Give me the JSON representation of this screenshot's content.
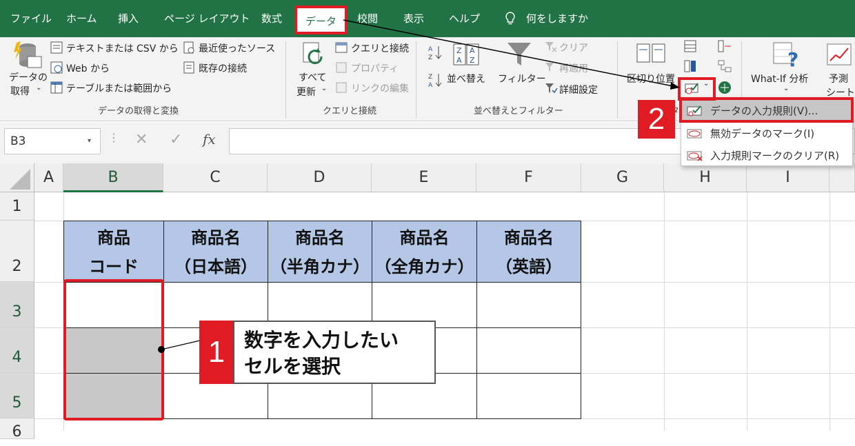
{
  "tabs": [
    "ファイル",
    "ホーム",
    "挿入",
    "ページ レイアウト",
    "数式",
    "データ",
    "校閲",
    "表示",
    "ヘルプ"
  ],
  "tell_me": "何をしますか",
  "ribbon": {
    "get_data": [
      "データの",
      "取得"
    ],
    "from_text_csv": "テキストまたは CSV から",
    "from_web": "Web から",
    "from_table": "テーブルまたは範囲から",
    "recent_sources": "最近使ったソース",
    "existing_connections": "既存の接続",
    "group_get_transform": "データの取得と変換",
    "refresh_all": [
      "すべて",
      "更新"
    ],
    "queries_connections": "クエリと接続",
    "properties": "プロパティ",
    "edit_links": "リンクの編集",
    "group_queries": "クエリと接続",
    "sort": "並べ替え",
    "filter": "フィルター",
    "clear": "クリア",
    "reapply": "再適用",
    "advanced": "詳細設定",
    "group_sort_filter": "並べ替えとフィルター",
    "text_to_columns": "区切り位置",
    "group_data_tools": "タ",
    "what_if": "What-If 分析",
    "forecast": [
      "予測",
      "シート"
    ]
  },
  "dropdown": {
    "items": [
      "データの入力規則(V)...",
      "無効データのマーク(I)",
      "入力規則マークのクリア(R)"
    ]
  },
  "formula_bar": {
    "name_box": "B3",
    "fx": "fx"
  },
  "columns": [
    "A",
    "B",
    "C",
    "D",
    "E",
    "F",
    "G",
    "H",
    "I"
  ],
  "rows": [
    "1",
    "2",
    "3",
    "4",
    "5",
    "6"
  ],
  "table": {
    "headers": [
      [
        "商品",
        "コード"
      ],
      [
        "商品名",
        "（日本語）"
      ],
      [
        "商品名",
        "（半角カナ）"
      ],
      [
        "商品名",
        "（全角カナ）"
      ],
      [
        "商品名",
        "（英語）"
      ]
    ]
  },
  "annotations": {
    "step1_number": "1",
    "step1_text": [
      "数字を入力したい",
      "セルを選択"
    ],
    "step2_number": "2"
  },
  "colors": {
    "excel_green": "#217346",
    "highlight_red": "#e01b24",
    "header_blue": "#b4c7e7",
    "selected_gray": "#c8c8c8"
  }
}
